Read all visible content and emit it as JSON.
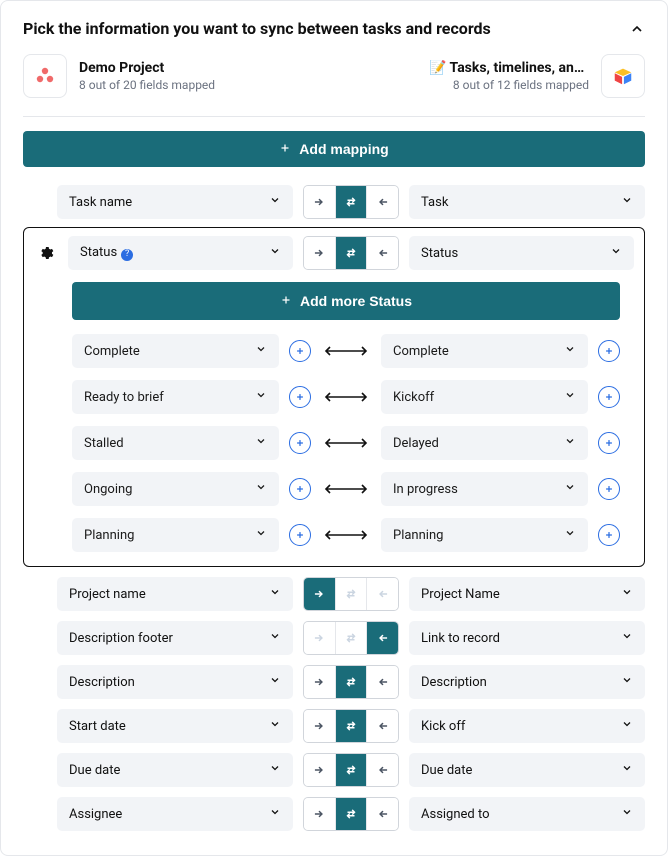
{
  "title": "Pick the information you want to sync between tasks and records",
  "leftApp": {
    "name": "Demo Project",
    "sub": "8 out of 20 fields mapped"
  },
  "rightApp": {
    "name": "📝 Tasks, timelines, and …",
    "sub": "8 out of 12 fields mapped"
  },
  "addMapping": "Add mapping",
  "topRow": {
    "left": "Task name",
    "right": "Task",
    "dir": "both"
  },
  "expanded": {
    "left": "Status",
    "right": "Status",
    "addMore": "Add more Status",
    "values": [
      {
        "l": "Complete",
        "r": "Complete"
      },
      {
        "l": "Ready to brief",
        "r": "Kickoff"
      },
      {
        "l": "Stalled",
        "r": "Delayed"
      },
      {
        "l": "Ongoing",
        "r": "In progress"
      },
      {
        "l": "Planning",
        "r": "Planning"
      }
    ]
  },
  "rows": [
    {
      "left": "Project name",
      "right": "Project Name",
      "dir": "ltr"
    },
    {
      "left": "Description footer",
      "right": "Link to record",
      "dir": "rtl"
    },
    {
      "left": "Description",
      "right": "Description",
      "dir": "both"
    },
    {
      "left": "Start date",
      "right": "Kick off",
      "dir": "both"
    },
    {
      "left": "Due date",
      "right": "Due date",
      "dir": "both"
    },
    {
      "left": "Assignee",
      "right": "Assigned to",
      "dir": "both"
    }
  ]
}
